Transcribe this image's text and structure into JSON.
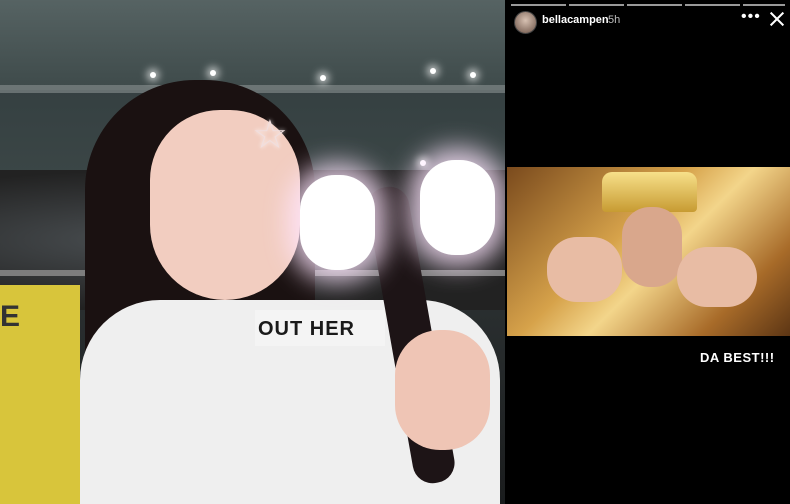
{
  "photo": {
    "shirt_text": "OUT HER",
    "sign_text": "E"
  },
  "story": {
    "username": "bellacampen",
    "time": "5h",
    "more_icon": "more-icon",
    "close_icon": "close-icon",
    "caption": "DA BEST!!!"
  }
}
